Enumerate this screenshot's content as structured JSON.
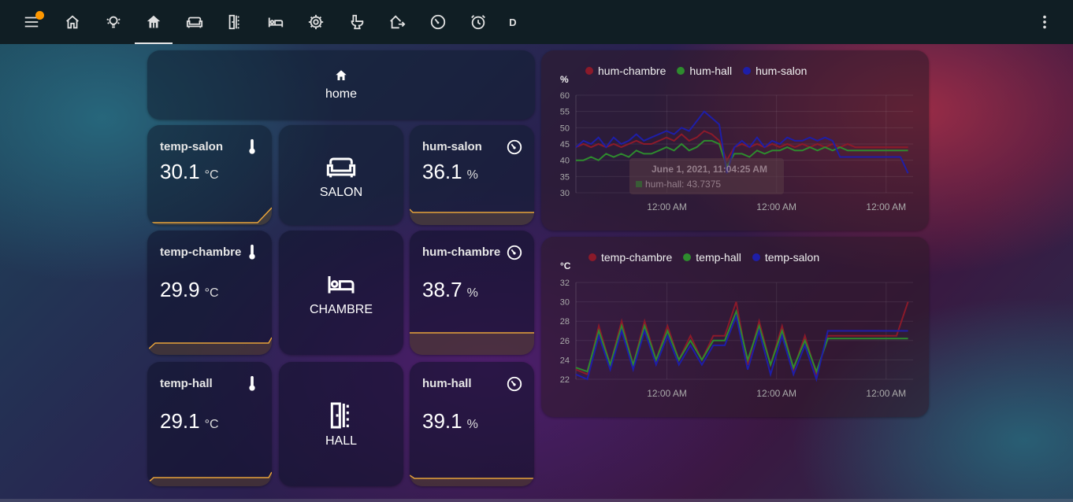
{
  "toolbar": {
    "menu_icon": "menu-icon",
    "notification_dot_color": "#ff9800",
    "tabs": [
      {
        "icon": "home-outline-icon",
        "active": false
      },
      {
        "icon": "lightbulb-group-icon",
        "active": false
      },
      {
        "icon": "home-filled-icon",
        "active": true
      },
      {
        "icon": "sofa-icon",
        "active": false
      },
      {
        "icon": "door-hall-icon",
        "active": false
      },
      {
        "icon": "bed-icon",
        "active": false
      },
      {
        "icon": "cog-icon",
        "active": false
      },
      {
        "icon": "toilet-icon",
        "active": false
      },
      {
        "icon": "home-export-icon",
        "active": false
      },
      {
        "icon": "gauge-icon",
        "active": false
      },
      {
        "icon": "alarm-icon",
        "active": false
      }
    ],
    "letter_tab": "D",
    "overflow_icon": "dots-vertical-icon"
  },
  "home_card": {
    "label": "home"
  },
  "sensors": {
    "temp_salon": {
      "name": "temp-salon",
      "value": "30.1",
      "unit": "°C",
      "icon": "thermometer-icon"
    },
    "hum_salon": {
      "name": "hum-salon",
      "value": "36.1",
      "unit": "%",
      "icon": "gauge-icon"
    },
    "temp_chambre": {
      "name": "temp-chambre",
      "value": "29.9",
      "unit": "°C",
      "icon": "thermometer-icon"
    },
    "hum_chambre": {
      "name": "hum-chambre",
      "value": "38.7",
      "unit": "%",
      "icon": "gauge-icon"
    },
    "temp_hall": {
      "name": "temp-hall",
      "value": "29.1",
      "unit": "°C",
      "icon": "thermometer-icon"
    },
    "hum_hall": {
      "name": "hum-hall",
      "value": "39.1",
      "unit": "%",
      "icon": "gauge-icon"
    }
  },
  "rooms": {
    "salon": {
      "label": "SALON",
      "icon": "sofa-icon"
    },
    "chambre": {
      "label": "CHAMBRE",
      "icon": "bed-icon"
    },
    "hall": {
      "label": "HALL",
      "icon": "door-hall-icon"
    }
  },
  "colors": {
    "chambre": "#8b1a2a",
    "hall": "#2e8b2e",
    "salon": "#1e1ea8",
    "sparkline": "#e8a33a"
  },
  "chart_data": [
    {
      "type": "line",
      "unit_label": "%",
      "yticks": [
        30,
        35,
        40,
        45,
        50,
        55,
        60
      ],
      "ylim": [
        30,
        60
      ],
      "xticks": [
        "12:00 AM",
        "12:00 AM",
        "12:00 AM"
      ],
      "grid": true,
      "legend_position": "top-left",
      "tooltip": {
        "title": "June 1, 2021, 11:04:25 AM",
        "line": "hum-hall: 43.7375"
      },
      "series": [
        {
          "name": "hum-chambre",
          "color": "#8b1a2a",
          "values": [
            44,
            45,
            44,
            45,
            44,
            45,
            44,
            45,
            46,
            45,
            45,
            46,
            47,
            46,
            48,
            46,
            47,
            49,
            48,
            46,
            40,
            44,
            45,
            44,
            45,
            44,
            45,
            44,
            45,
            44,
            45,
            44,
            45,
            44,
            45,
            44,
            45,
            44,
            44,
            44,
            44,
            44,
            44,
            44,
            44
          ]
        },
        {
          "name": "hum-hall",
          "color": "#2e8b2e",
          "values": [
            40,
            40,
            41,
            40,
            42,
            41,
            42,
            41,
            43,
            42,
            42,
            43,
            44,
            43,
            45,
            43,
            44,
            46,
            46,
            45,
            38,
            42,
            42,
            41,
            43,
            42,
            43,
            43,
            44,
            43,
            43,
            44,
            43,
            44,
            43,
            44,
            43,
            43,
            43,
            43,
            43,
            43,
            43,
            43,
            43
          ]
        },
        {
          "name": "hum-salon",
          "color": "#1e1ea8",
          "values": [
            44,
            46,
            45,
            47,
            44,
            47,
            45,
            46,
            48,
            46,
            47,
            48,
            49,
            48,
            50,
            49,
            52,
            55,
            53,
            51,
            36,
            44,
            46,
            44,
            47,
            44,
            46,
            45,
            47,
            46,
            46,
            47,
            46,
            47,
            46,
            41,
            41,
            41,
            41,
            41,
            41,
            41,
            41,
            41,
            36
          ]
        }
      ]
    },
    {
      "type": "line",
      "unit_label": "°C",
      "yticks": [
        22,
        24,
        26,
        28,
        30,
        32
      ],
      "ylim": [
        22,
        32
      ],
      "xticks": [
        "12:00 AM",
        "12:00 AM",
        "12:00 AM"
      ],
      "grid": true,
      "legend_position": "top-left",
      "series": [
        {
          "name": "temp-chambre",
          "color": "#8b1a2a",
          "values": [
            23,
            22.5,
            27.5,
            23.5,
            28,
            23.5,
            28,
            24,
            27.5,
            24,
            26.5,
            24,
            26.5,
            26.5,
            30,
            23.5,
            28,
            23.5,
            27.5,
            23,
            26.5,
            22.5,
            26.5,
            26.5,
            26.5,
            26.5,
            26.5,
            26.5,
            26.5,
            30
          ]
        },
        {
          "name": "temp-hall",
          "color": "#2e8b2e",
          "values": [
            23.2,
            22.8,
            27,
            23.5,
            27.5,
            23.5,
            27.5,
            24,
            27,
            24,
            26,
            24,
            26,
            26,
            29,
            24,
            27.5,
            23.5,
            27,
            23.2,
            26,
            22.8,
            26.2,
            26.2,
            26.2,
            26.2,
            26.2,
            26.2,
            26.2,
            26.2
          ]
        },
        {
          "name": "temp-salon",
          "color": "#1e1ea8",
          "values": [
            22.5,
            22,
            26.5,
            23,
            27,
            23,
            27,
            23.5,
            26.5,
            23.5,
            25.5,
            23.5,
            25.5,
            25.5,
            28.5,
            23,
            27,
            22.5,
            26.5,
            22.5,
            25.5,
            22,
            27,
            27,
            27,
            27,
            27,
            27,
            27,
            27
          ]
        }
      ]
    }
  ]
}
